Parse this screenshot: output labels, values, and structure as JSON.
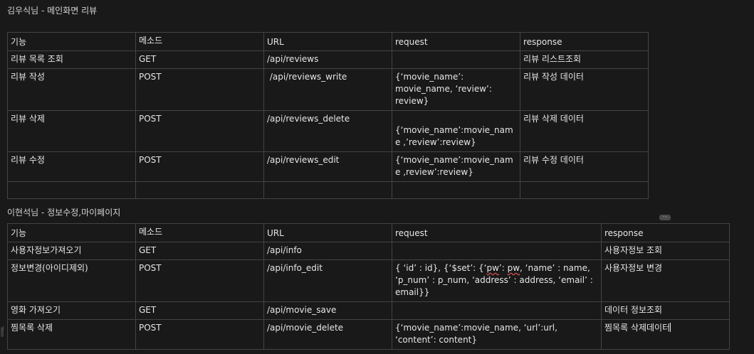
{
  "section1": {
    "title": "김우식님 - 메인화면 리뷰",
    "headers": [
      "기능",
      "메소드",
      "URL",
      "request",
      "response"
    ],
    "rows": [
      {
        "feature": "리뷰 목록 조회",
        "method": "GET",
        "url": "/api/reviews",
        "request": "",
        "response": "리뷰 리스트조회"
      },
      {
        "feature": "리뷰 작성",
        "method": "POST",
        "url": " /api/reviews_write",
        "request": " {‘movie_name’: movie_name, ‘review’: review}",
        "response": "리뷰 작성 데이터"
      },
      {
        "feature": "리뷰 삭제",
        "method": "POST",
        "url": "/api/reviews_delete",
        "request": "{‘movie_name’:movie_name ,’review’:review}",
        "response": "리뷰 삭제 데이터"
      },
      {
        "feature": "리뷰 수정",
        "method": "POST",
        "url": "/api/reviews_edit",
        "request": "{‘movie_name’:movie_name ,review’:review}",
        "response": "리뷰 수정 데이터"
      },
      {
        "feature": "",
        "method": "",
        "url": "",
        "request": "",
        "response": ""
      }
    ]
  },
  "section2": {
    "title": "이현석님 - 정보수정,마이페이지",
    "headers": [
      "기능",
      "메소드",
      "URL",
      "request",
      "response"
    ],
    "rows": [
      {
        "feature": "사용자정보가져오기",
        "method": "GET",
        "url": "/api/info",
        "request": "",
        "response": "사용자정보 조회"
      },
      {
        "feature": "정보변경(아이디제외)",
        "method": "POST",
        "url": "/api/info_edit",
        "request_pre": "{ ‘id’ : id}, {‘$set’: {‘",
        "request_pw": "pw",
        "request_mid": "’: ",
        "request_pw2": "pw",
        "request_post": ", ‘name’ : name, ‘p_num’ : p_num, ‘address’ : address, ‘email’ : email}}",
        "response": "사용자정보 변경"
      },
      {
        "feature": "영화 가져오기",
        "method": "GET",
        "url": "/api/movie_save",
        "request": "",
        "response": "데이터 정보조회"
      },
      {
        "feature": "찜목록 삭제",
        "method": "POST",
        "url": "/api/movie_delete",
        "request": "{‘movie_name’:movie_name, ‘url’:url, ‘content’: content}",
        "response": "찜목록 삭제데이터"
      }
    ]
  },
  "ui": {
    "more_button": "···",
    "drag_handle": "⋮"
  }
}
